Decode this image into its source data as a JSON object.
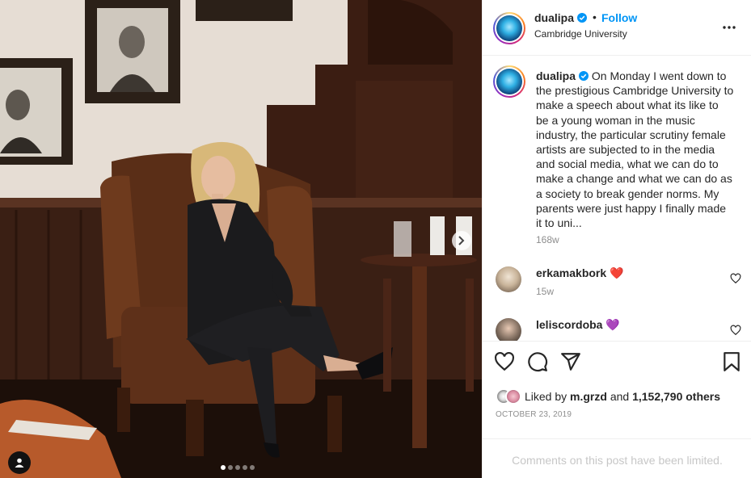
{
  "post": {
    "username": "dualipa",
    "follow_label": "Follow",
    "separator": "•",
    "location": "Cambridge University",
    "caption": " On Monday I went down to the prestigious Cambridge University to make a speech about what its like to be a young woman in the music industry, the particular scrutiny female artists are subjected to in the media and social media, what we can do to make a change and what we can do as a society to break gender norms. My parents were just happy I finally made it to uni...",
    "caption_time": "168w",
    "media": {
      "slide_count": 5,
      "active_slide": 0
    }
  },
  "comments": [
    {
      "username": "erkamakbork",
      "emoji": "❤️",
      "time": "15w"
    },
    {
      "username": "leliscordoba",
      "emoji": "💜",
      "time": ""
    }
  ],
  "likes": {
    "prefix": "Liked by ",
    "first_user": "m.grzd",
    "joiner": " and ",
    "others": "1,152,790 others"
  },
  "date": "OCTOBER 23, 2019",
  "comments_limited": "Comments on this post have been limited.",
  "icons": [
    "verified-icon",
    "more-options-icon",
    "heart-icon",
    "comment-icon",
    "share-icon",
    "bookmark-icon",
    "chevron-right-icon",
    "user-tag-icon"
  ],
  "colors": {
    "accent": "#0095f6",
    "text": "#262626",
    "secondary": "#8e8e8e",
    "heart_red": "#ed4956",
    "purple_heart": "#9b6be3"
  }
}
